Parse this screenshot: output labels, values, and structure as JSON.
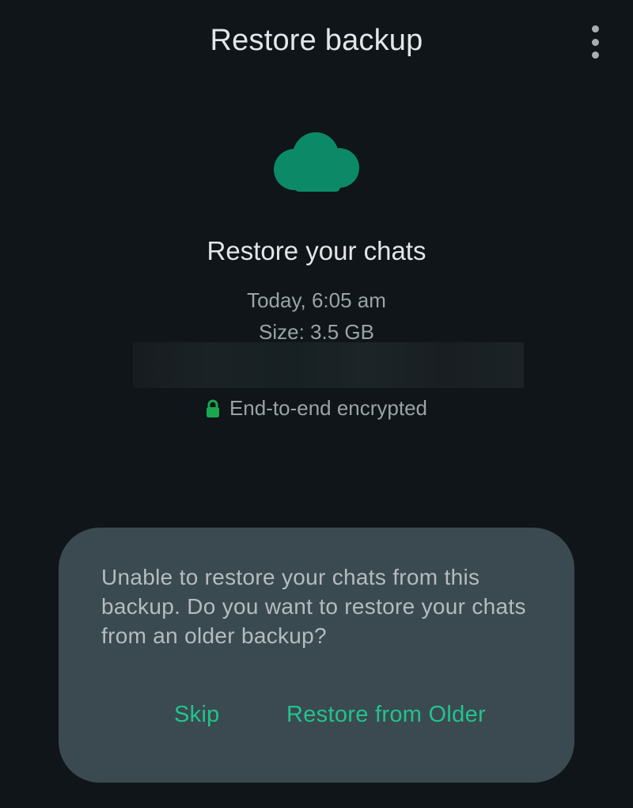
{
  "header": {
    "title": "Restore backup",
    "menu_icon": "more-vert-icon"
  },
  "backup": {
    "icon": "cloud-icon",
    "headline": "Restore your chats",
    "date": "Today, 6:05 am",
    "size": "Size: 3.5 GB",
    "encryption_icon": "lock-icon",
    "encryption_label": "End-to-end encrypted"
  },
  "dialog": {
    "message": "Unable to restore your chats from this backup. Do you want to restore your chats from an older backup?",
    "skip_label": "Skip",
    "restore_older_label": "Restore from Older"
  },
  "colors": {
    "background": "#0f1518",
    "accent": "#21c38e",
    "cloud": "#0c8a68",
    "lock": "#1aa750",
    "dialog": "#3b4a50"
  }
}
